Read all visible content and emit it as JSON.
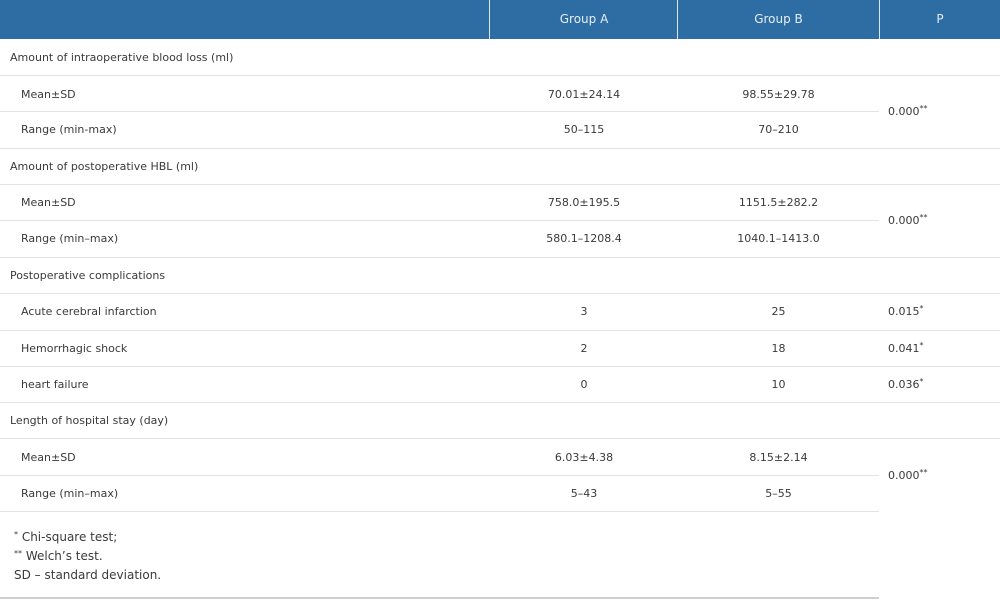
{
  "header": {
    "col0": "",
    "col_a": "Group A",
    "col_b": "Group B",
    "col_p": "P"
  },
  "sections": [
    {
      "label": "Amount of intraoperative blood loss (ml)",
      "rows": [
        {
          "label": "Mean±SD",
          "a": "70.01±24.14",
          "b": "98.55±29.78"
        },
        {
          "label": "Range (min-max)",
          "a": "50–115",
          "b": "70–210"
        }
      ],
      "p": {
        "value": "0.000",
        "mark": "**"
      }
    },
    {
      "label": "Amount of postoperative HBL (ml)",
      "rows": [
        {
          "label": "Mean±SD",
          "a": "758.0±195.5",
          "b": "1151.5±282.2"
        },
        {
          "label": "Range (min–max)",
          "a": "580.1–1208.4",
          "b": "1040.1–1413.0"
        }
      ],
      "p": {
        "value": "0.000",
        "mark": "**"
      }
    },
    {
      "label": "Postoperative complications",
      "rows": [
        {
          "label": "Acute cerebral infarction",
          "a": "3",
          "b": "25",
          "p": "0.015",
          "mark": "*"
        },
        {
          "label": "Hemorrhagic shock",
          "a": "2",
          "b": "18",
          "p": "0.041",
          "mark": "*"
        },
        {
          "label": "heart failure",
          "a": "0",
          "b": "10",
          "p": "0.036",
          "mark": "*"
        }
      ]
    },
    {
      "label": "Length of hospital stay (day)",
      "rows": [
        {
          "label": "Mean±SD",
          "a": "6.03±4.38",
          "b": "8.15±2.14"
        },
        {
          "label": "Range (min–max)",
          "a": "5–43",
          "b": "5–55"
        }
      ],
      "p": {
        "value": "0.000",
        "mark": "**"
      }
    }
  ],
  "footnotes": [
    {
      "mark": "*",
      "text": " Chi-square test;"
    },
    {
      "mark": "**",
      "text": " Welch’s test."
    },
    {
      "mark": "",
      "text": "SD – standard deviation."
    }
  ]
}
